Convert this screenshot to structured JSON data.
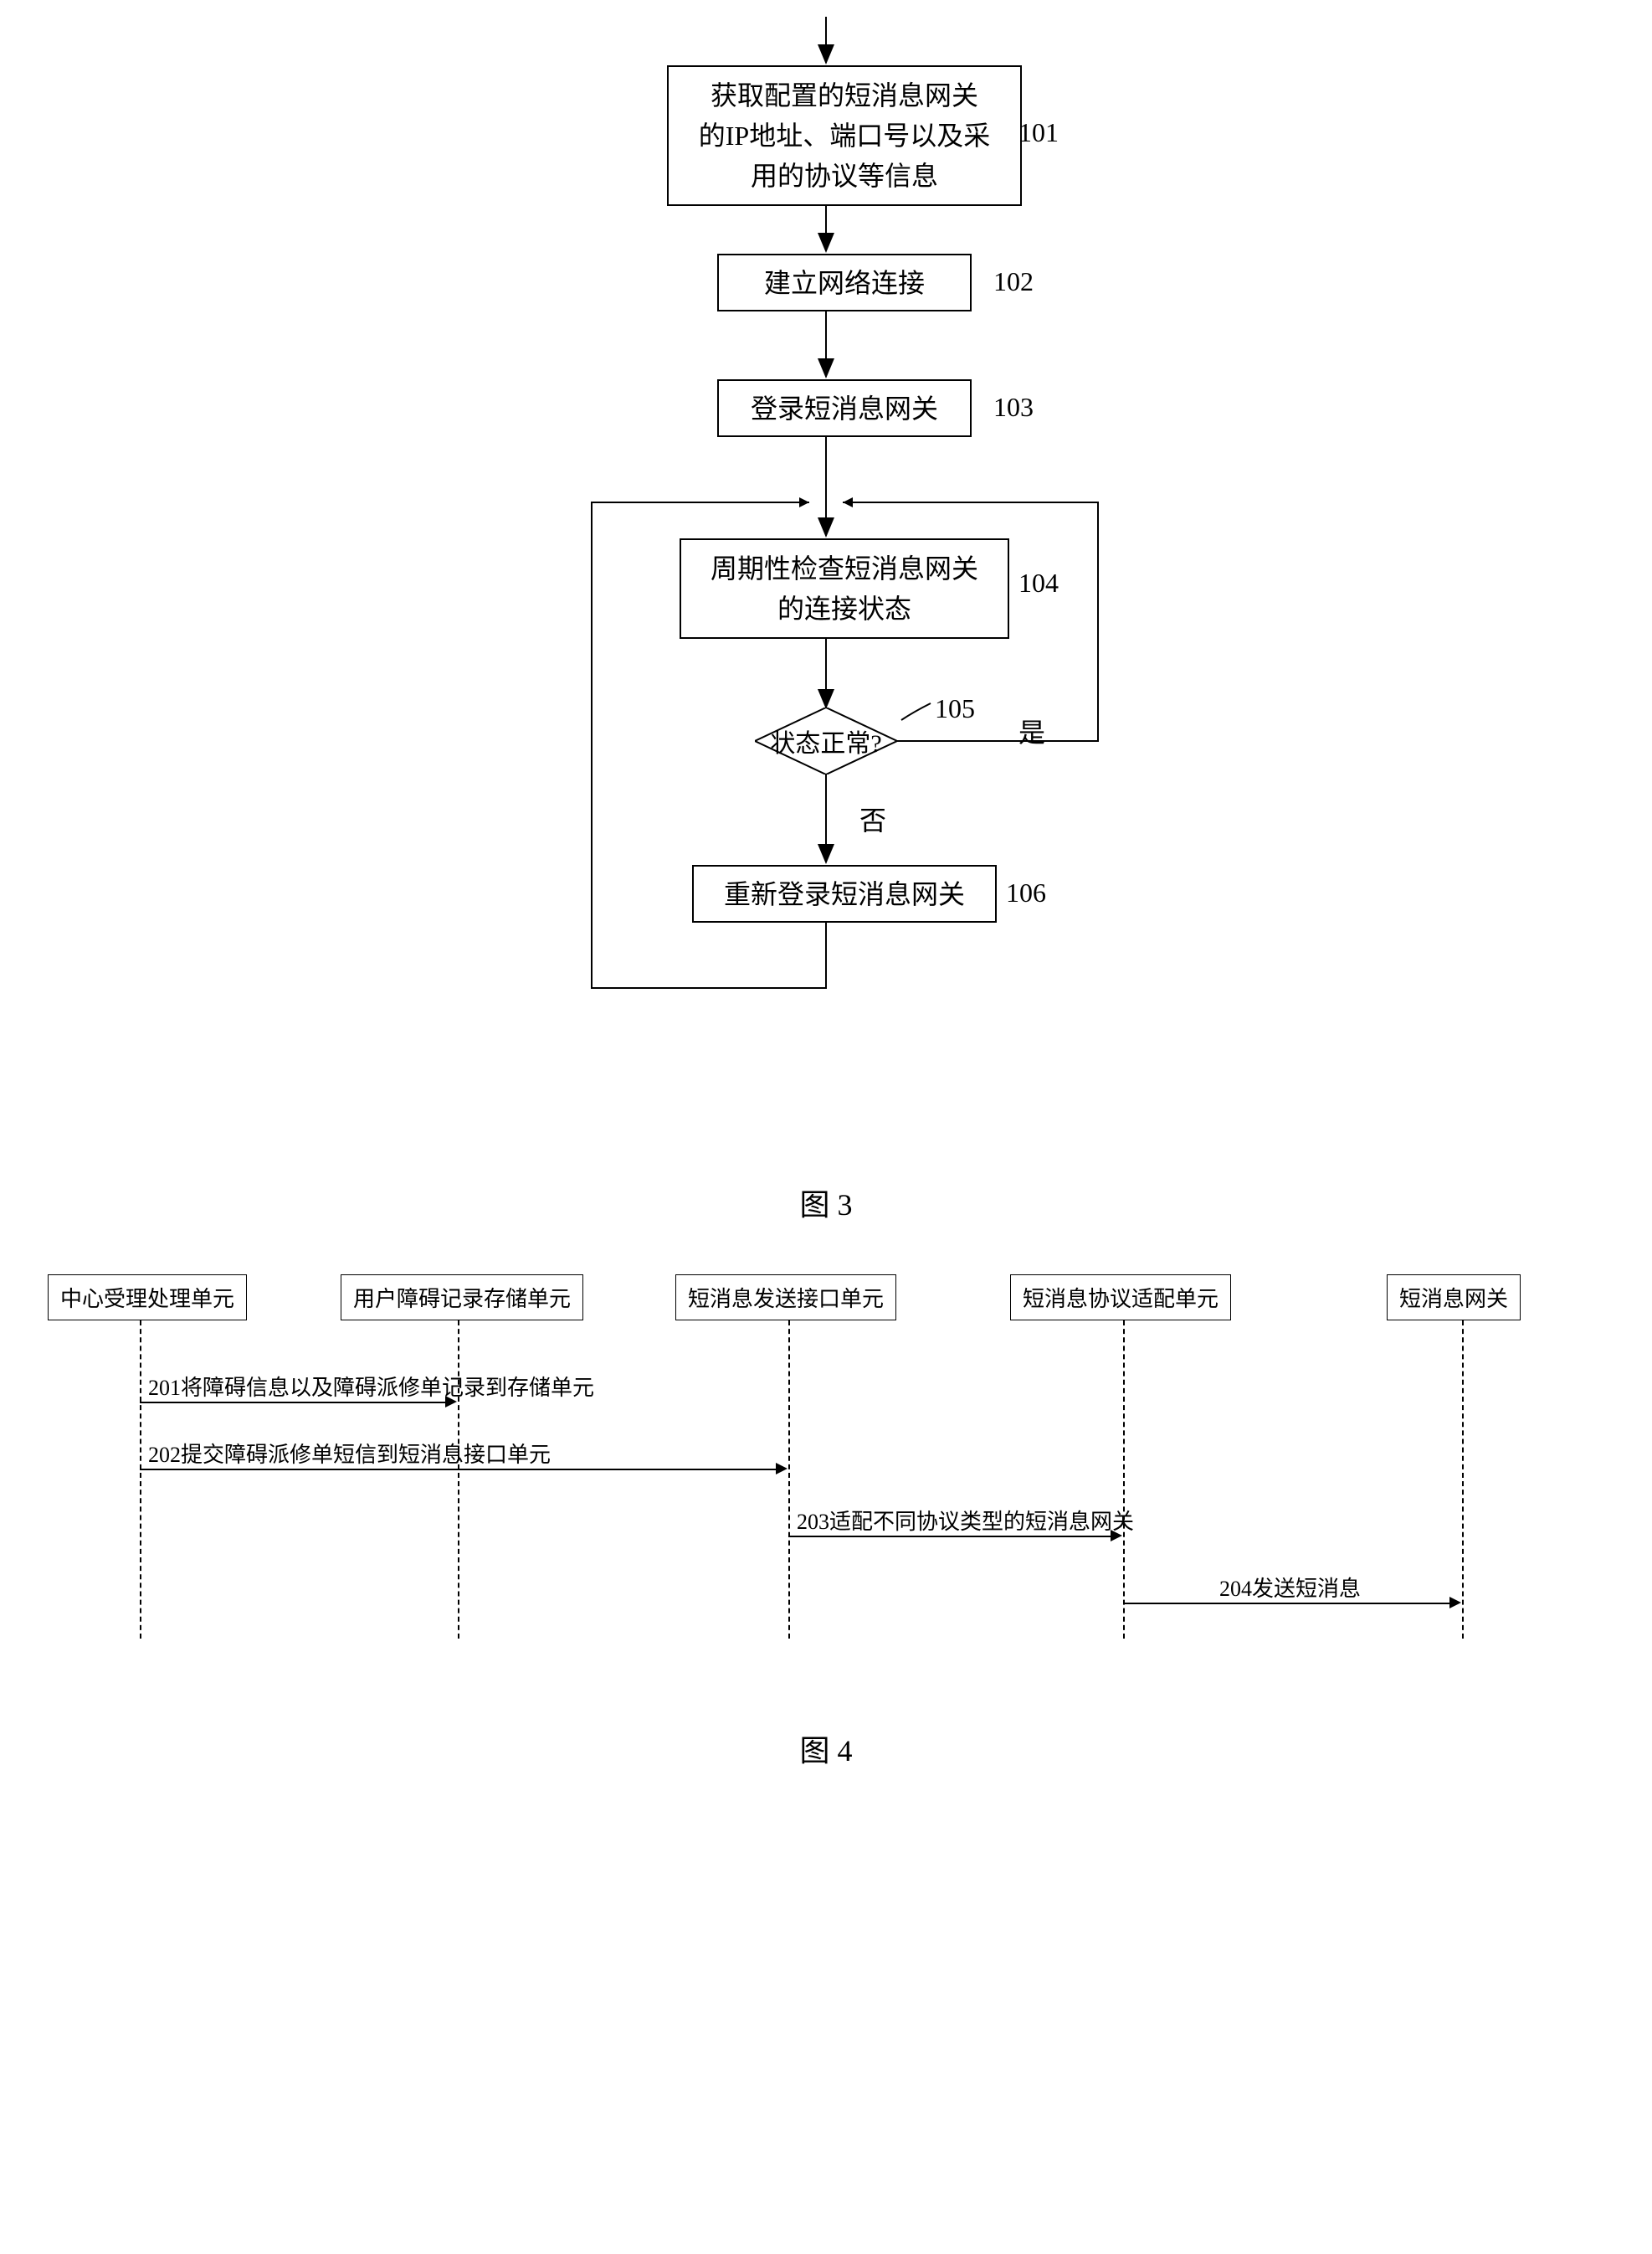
{
  "fig3": {
    "step101": {
      "text": "获取配置的短消息网关\n的IP地址、端口号以及采\n用的协议等信息",
      "num": "101"
    },
    "step102": {
      "text": "建立网络连接",
      "num": "102"
    },
    "step103": {
      "text": "登录短消息网关",
      "num": "103"
    },
    "step104": {
      "text": "周期性检查短消息网关\n的连接状态",
      "num": "104"
    },
    "step105": {
      "text": "状态正常?",
      "num": "105",
      "yes": "是",
      "no": "否"
    },
    "step106": {
      "text": "重新登录短消息网关",
      "num": "106"
    },
    "caption": "图 3"
  },
  "fig4": {
    "actors": {
      "a1": "中心受理处理单元",
      "a2": "用户障碍记录存储单元",
      "a3": "短消息发送接口单元",
      "a4": "短消息协议适配单元",
      "a5": "短消息网关"
    },
    "messages": {
      "m201": "201将障碍信息以及障碍派修单记录到存储单元",
      "m202": "202提交障碍派修单短信到短消息接口单元",
      "m203": "203适配不同协议类型的短消息网关",
      "m204": "204发送短消息"
    },
    "caption": "图 4"
  }
}
